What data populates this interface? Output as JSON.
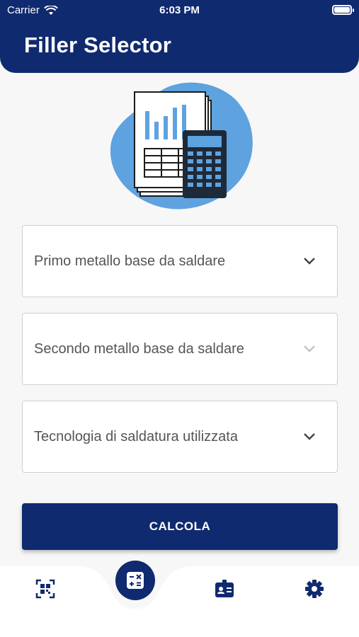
{
  "status_bar": {
    "carrier": "Carrier",
    "time": "6:03 PM"
  },
  "header": {
    "title": "Filler Selector"
  },
  "form": {
    "first_metal": {
      "placeholder": "Primo metallo base da saldare",
      "chevron": "chevron-down-icon",
      "enabled": true
    },
    "second_metal": {
      "placeholder": "Secondo metallo base da saldare",
      "chevron": "chevron-down-icon",
      "enabled": false
    },
    "technology": {
      "placeholder": "Tecnologia di saldatura utilizzata",
      "chevron": "chevron-down-icon",
      "enabled": true
    }
  },
  "actions": {
    "calculate_label": "CALCOLA"
  },
  "tab_bar": {
    "items": [
      {
        "icon": "qr-code-icon",
        "active": false
      },
      {
        "icon": "calculator-icon",
        "active": true
      },
      {
        "icon": "id-badge-icon",
        "active": false
      },
      {
        "icon": "gear-icon",
        "active": false
      }
    ]
  },
  "colors": {
    "primary": "#102a6f",
    "accent": "#5ea2e0",
    "background": "#f7f7f7"
  }
}
